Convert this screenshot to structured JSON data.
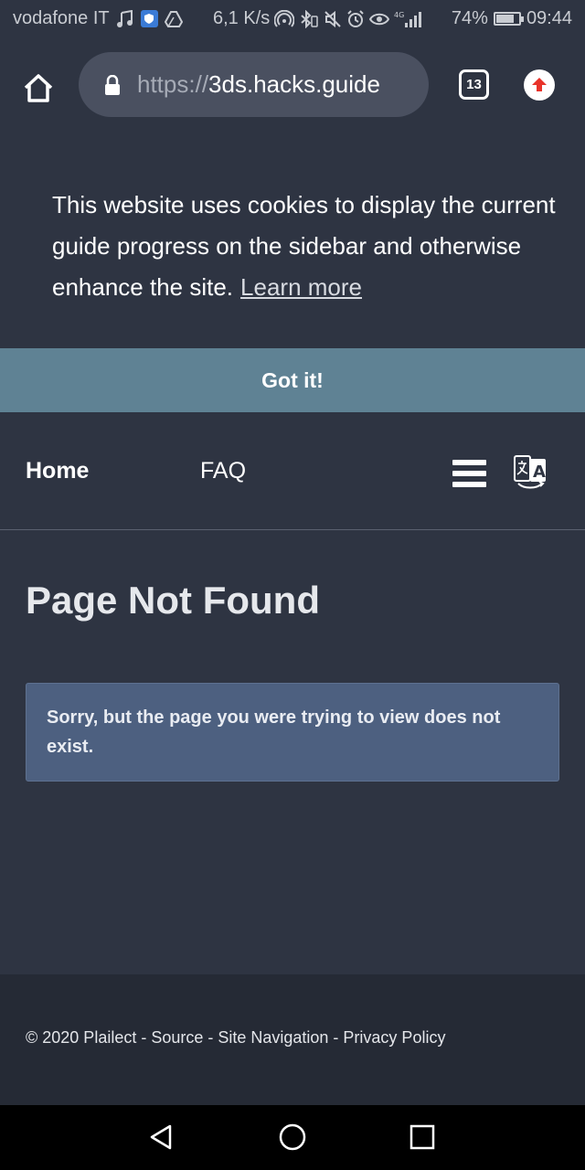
{
  "status_bar": {
    "carrier": "vodafone IT",
    "speed": "6,1 K/s",
    "battery": "74%",
    "battery_level": 0.74,
    "time": "09:44",
    "icons_left": [
      "music-note-icon",
      "shield-icon",
      "drive-icon"
    ],
    "icons_right": [
      "hotspot-icon",
      "bluetooth-icon",
      "mute-icon",
      "alarm-icon",
      "eye-icon",
      "signal-icon"
    ]
  },
  "browser": {
    "url_scheme": "https://",
    "url_host": "3ds.hacks.guide",
    "tab_count": "13"
  },
  "cookie_banner": {
    "message": "This website uses cookies to display the current guide progress on the sidebar and otherwise enhance the site.",
    "learn_more": "Learn more",
    "accept_label": "Got it!"
  },
  "nav": {
    "home": "Home",
    "faq": "FAQ"
  },
  "main": {
    "title": "Page Not Found",
    "message": "Sorry, but the page you were trying to view does not exist."
  },
  "footer": {
    "text": "© 2020 Plailect - Source - Site Navigation - Privacy Policy"
  },
  "colors": {
    "background": "#2e3442",
    "accept_bar": "#5f8294",
    "alert": "#4d6080",
    "footer": "#252a35",
    "update_arrow": "#e8332a"
  }
}
